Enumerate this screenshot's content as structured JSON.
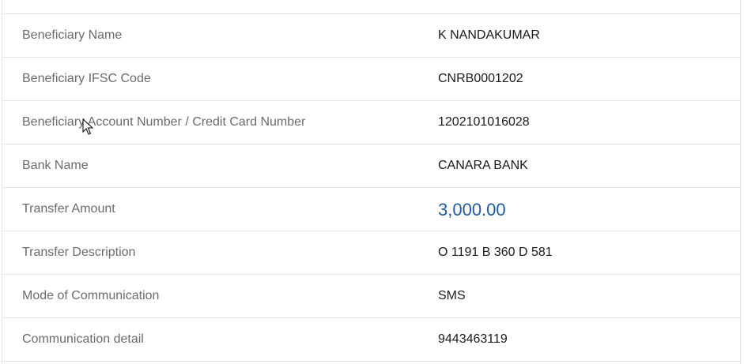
{
  "rows": [
    {
      "label": "Beneficiary Name",
      "value": "K NANDAKUMAR"
    },
    {
      "label": "Beneficiary IFSC Code",
      "value": "CNRB0001202"
    },
    {
      "label": "Beneficiary Account Number / Credit Card Number",
      "value": "1202101016028"
    },
    {
      "label": "Bank Name",
      "value": "CANARA BANK"
    },
    {
      "label": "Transfer Amount",
      "value": "3,000.00"
    },
    {
      "label": "Transfer Description",
      "value": "O 1191 B 360 D 581"
    },
    {
      "label": "Mode of Communication",
      "value": "SMS"
    },
    {
      "label": "Communication detail",
      "value": "9443463119"
    }
  ],
  "colors": {
    "label": "#6b6b6b",
    "value": "#1a1a1a",
    "amount": "#1f5a9e",
    "border": "#e2e2e2"
  },
  "icons": {
    "cursor": "mouse-pointer-icon"
  }
}
